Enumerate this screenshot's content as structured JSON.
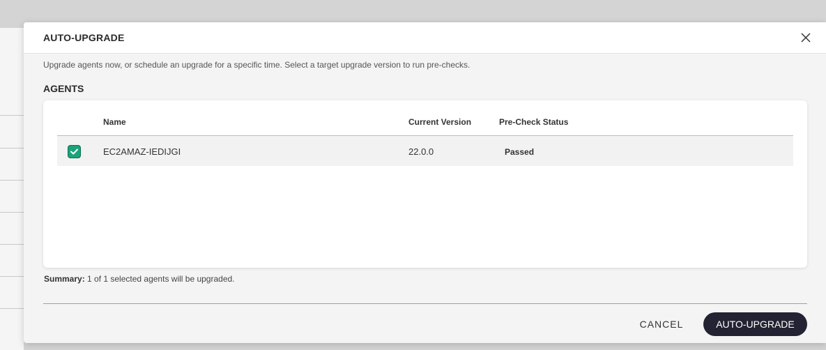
{
  "modal": {
    "title": "AUTO-UPGRADE",
    "description": "Upgrade agents now, or schedule an upgrade for a specific time. Select a target upgrade version to run pre-checks.",
    "section_title": "AGENTS"
  },
  "table": {
    "columns": [
      "Name",
      "Current Version",
      "Pre-Check Status"
    ],
    "rows": [
      {
        "checked": true,
        "name": "EC2AMAZ-IEDIJGI",
        "version": "22.0.0",
        "status": "Passed"
      }
    ]
  },
  "summary": {
    "label": "Summary:",
    "text": " 1 of 1 selected agents will be upgraded."
  },
  "footer": {
    "cancel_label": "CANCEL",
    "submit_label": "AUTO-UPGRADE"
  },
  "icons": {
    "close": "close-icon",
    "checkbox": "checkmark-icon"
  },
  "colors": {
    "checkbox_fill": "#1aa37a",
    "primary_button": "#232333"
  }
}
